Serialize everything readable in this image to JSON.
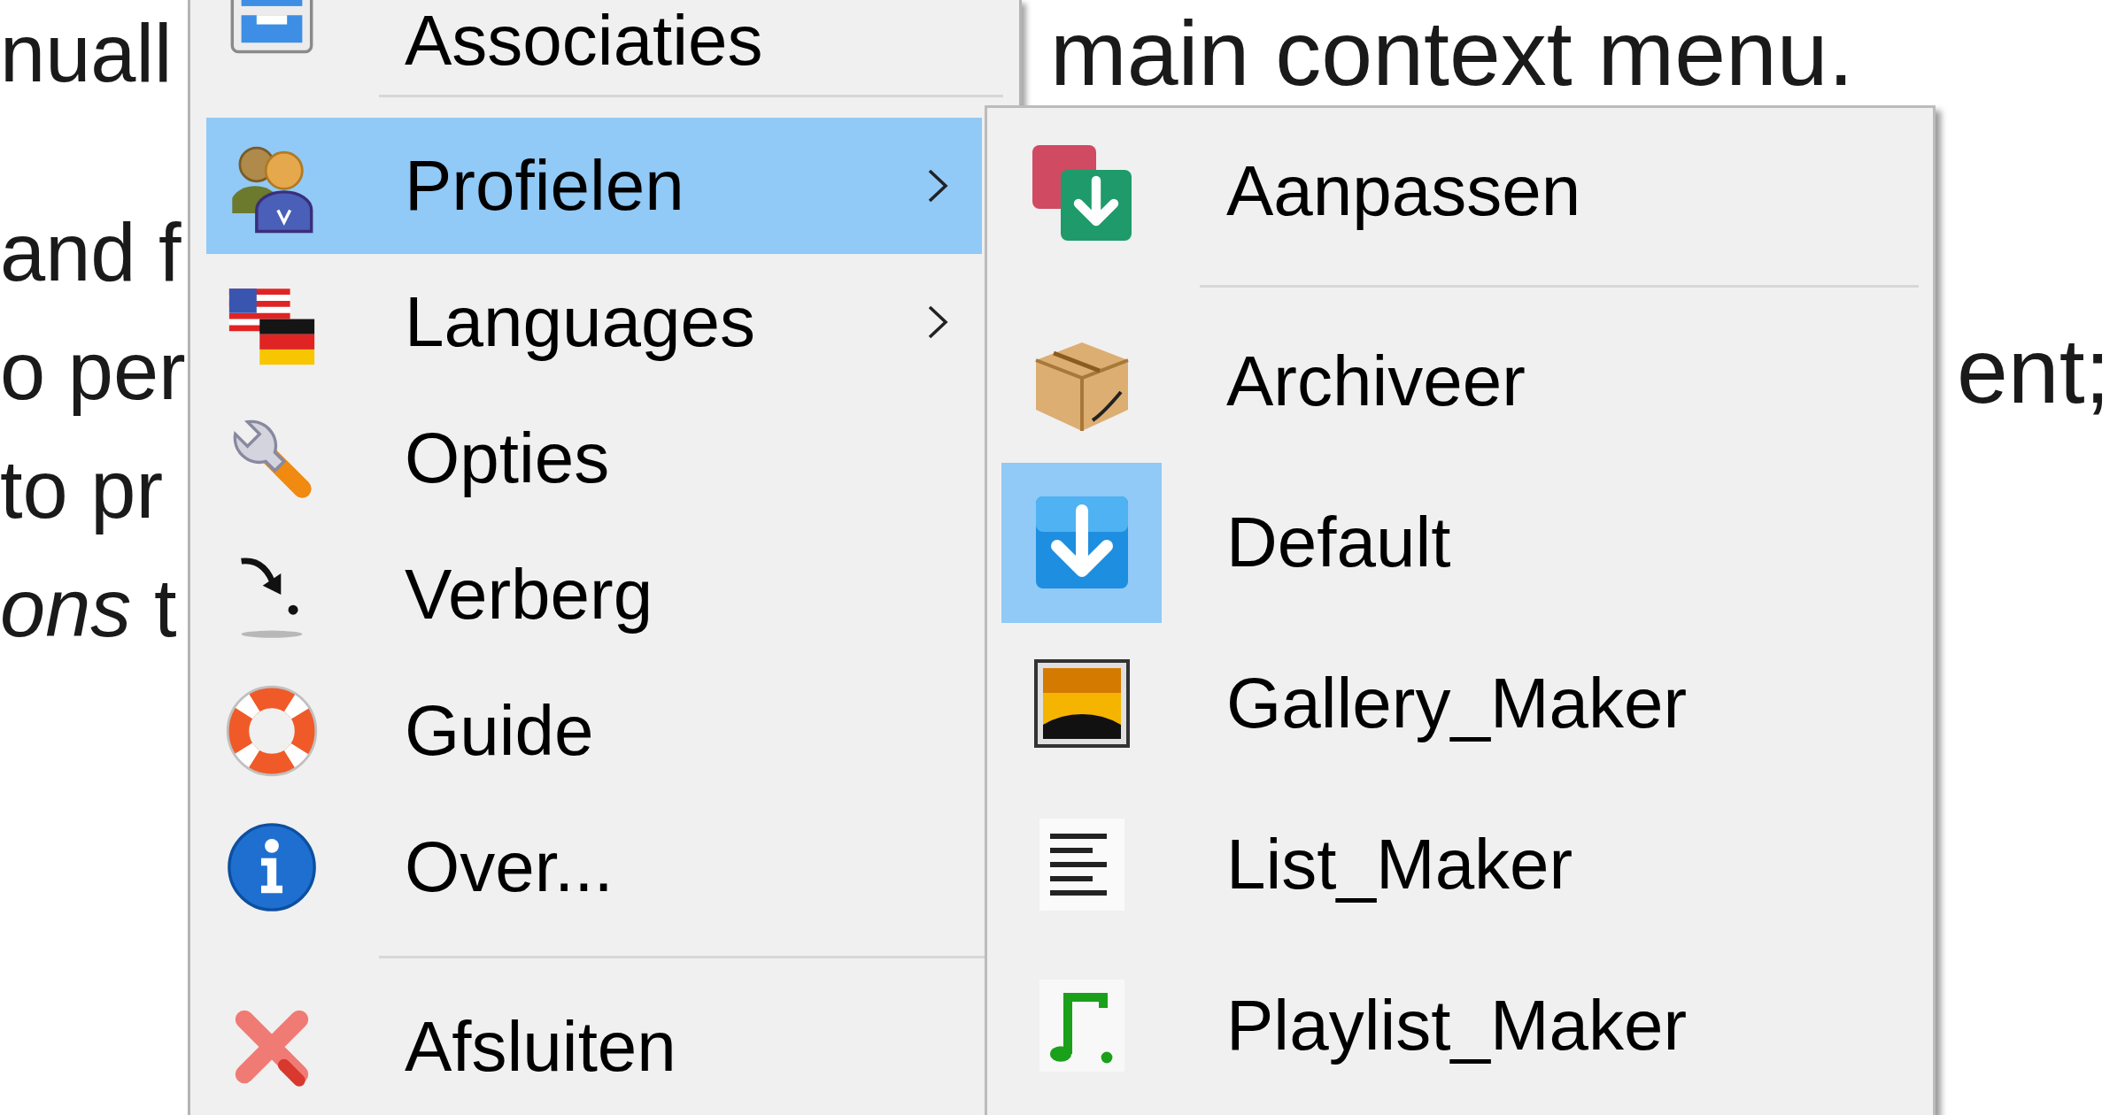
{
  "document": {
    "lines": [
      {
        "left": "nuall",
        "right": "main context menu."
      },
      {
        "left": "and f"
      },
      {
        "left": "o per",
        "right": "ent;"
      },
      {
        "left": "to pr"
      },
      {
        "left": "*ons* t"
      }
    ]
  },
  "context_menu": {
    "items": [
      {
        "kind": "item",
        "label": "Associaties",
        "selected": false,
        "has_submenu": false
      },
      {
        "kind": "separator"
      },
      {
        "kind": "item",
        "label": "Profielen",
        "selected": true,
        "has_submenu": true,
        "submenu": {
          "items": [
            {
              "kind": "item",
              "label": "Aanpassen",
              "selected": false,
              "checked": false
            },
            {
              "kind": "separator"
            },
            {
              "kind": "item",
              "label": "Archiveer",
              "selected": false,
              "checked": false
            },
            {
              "kind": "item",
              "label": "Default",
              "selected": false,
              "checked": true
            },
            {
              "kind": "item",
              "label": "Gallery_Maker",
              "selected": false,
              "checked": false
            },
            {
              "kind": "item",
              "label": "List_Maker",
              "selected": false,
              "checked": false
            },
            {
              "kind": "item",
              "label": "Playlist_Maker",
              "selected": false,
              "checked": false
            }
          ]
        }
      },
      {
        "kind": "item",
        "label": "Languages",
        "selected": false,
        "has_submenu": true
      },
      {
        "kind": "item",
        "label": "Opties",
        "selected": false,
        "has_submenu": false
      },
      {
        "kind": "item",
        "label": "Verberg",
        "selected": false,
        "has_submenu": false
      },
      {
        "kind": "item",
        "label": "Guide",
        "selected": false,
        "has_submenu": false
      },
      {
        "kind": "item",
        "label": "Over...",
        "selected": false,
        "has_submenu": false
      },
      {
        "kind": "separator"
      },
      {
        "kind": "item",
        "label": "Afsluiten",
        "selected": false,
        "has_submenu": false
      }
    ]
  }
}
